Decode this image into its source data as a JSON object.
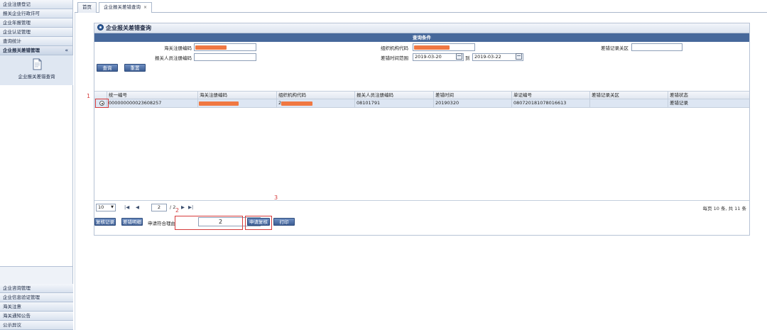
{
  "sidebar": {
    "top_items": [
      {
        "label": "企业注册登记"
      },
      {
        "label": "报关企业行政许可"
      },
      {
        "label": "企业年报管理"
      },
      {
        "label": "企业认证管理"
      },
      {
        "label": "查询统计"
      },
      {
        "label": "企业报关差错管理"
      }
    ],
    "active_chevron": "«",
    "tool_label": "企业报关差错查询",
    "bottom_items": [
      {
        "label": "企业咨询管理"
      },
      {
        "label": "企业信息验证管理"
      },
      {
        "label": "海关注意"
      },
      {
        "label": "海关通知公告"
      },
      {
        "label": "公示异议"
      }
    ]
  },
  "tabs": {
    "home": "首页",
    "current": "企业报关差错查询",
    "close": "×"
  },
  "panel": {
    "title": "企业报关差错查询",
    "condition_header": "查询条件",
    "labels": {
      "customs_code": "海关注册编码",
      "org_code": "组织机构代码",
      "error_area": "差错记录关区",
      "declarant_code": "报关人员注册编码",
      "time_range": "差错时间范围",
      "to": "到"
    },
    "date_from": "2019-03-20",
    "date_to": "2019-03-22",
    "buttons": {
      "query": "查询",
      "reset": "重置"
    }
  },
  "grid": {
    "columns": [
      "统一编号",
      "海关注册编码",
      "组织机构代码",
      "报关人员注册编码",
      "差错时间",
      "单证编号",
      "差错记录关区",
      "差错状态"
    ],
    "rows": [
      {
        "unified_no": "000000000023608257",
        "org_code_prefix": "2",
        "declarant_code": "08101791",
        "error_time": "20190320",
        "doc_no": "080720181078016613",
        "area": "",
        "status": "差错记录"
      }
    ]
  },
  "pager": {
    "page_size": "10",
    "page_input": "2",
    "total_pages_text": "/ 2",
    "info": "每页 10 条, 共 11 条"
  },
  "actions": {
    "review_record": "复核记录",
    "error_detail": "差错明细",
    "reason_label": "申请符合理由",
    "reason_value": "2",
    "apply_review": "申请复核",
    "print": "打印"
  },
  "annotations": {
    "n1": "1",
    "n2": "2",
    "n3": "3"
  },
  "colors": {
    "accent": "#46689b",
    "redaction": "#f07842",
    "annotation": "#d63b3b"
  }
}
